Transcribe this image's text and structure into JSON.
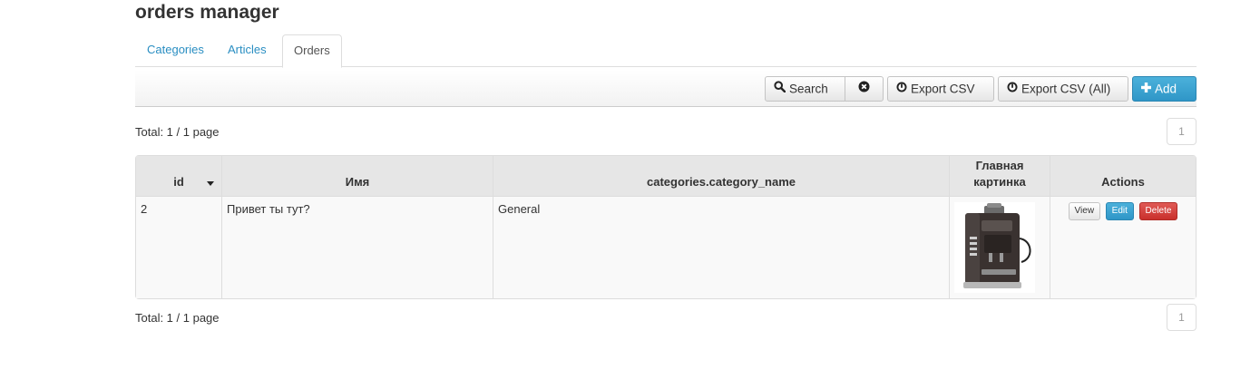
{
  "page": {
    "title": "orders manager"
  },
  "tabs": [
    {
      "label": "Categories",
      "active": false
    },
    {
      "label": "Articles",
      "active": false
    },
    {
      "label": "Orders",
      "active": true
    }
  ],
  "toolbar": {
    "search_label": "Search",
    "export_csv_label": "Export CSV",
    "export_csv_all_label": "Export CSV (All)",
    "add_label": "Add"
  },
  "summary": {
    "total_text": "Total: 1 / 1 page",
    "page": "1"
  },
  "table": {
    "columns": {
      "id": "id",
      "name": "Имя",
      "category": "categories.category_name",
      "image": "Главная картинка",
      "actions": "Actions"
    },
    "rows": [
      {
        "id": "2",
        "name": "Привет ты тут?",
        "category": "General",
        "image_icon": "coffee-machine-image"
      }
    ],
    "row_actions": {
      "view": "View",
      "edit": "Edit",
      "delete": "Delete"
    }
  },
  "colors": {
    "accent": "#2f96c7",
    "danger": "#c9302c",
    "link": "#2a8ec2"
  }
}
